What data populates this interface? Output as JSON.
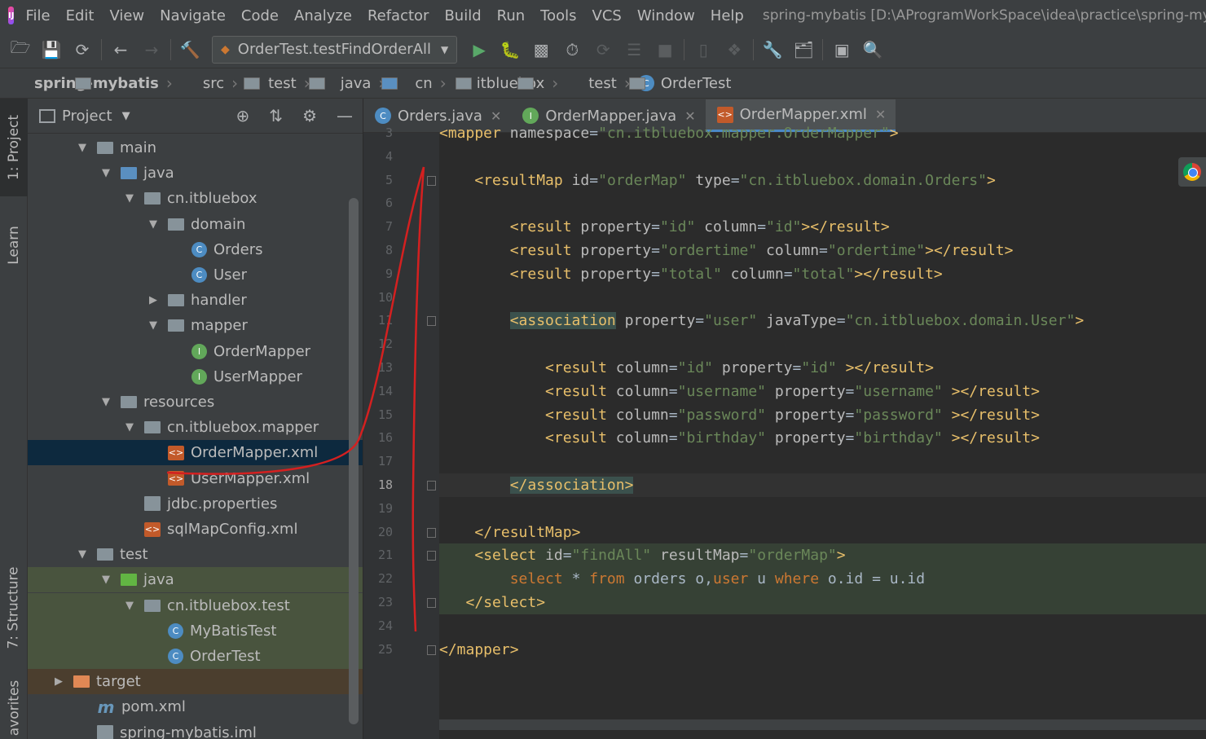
{
  "menu": [
    "File",
    "Edit",
    "View",
    "Navigate",
    "Code",
    "Analyze",
    "Refactor",
    "Build",
    "Run",
    "Tools",
    "VCS",
    "Window",
    "Help"
  ],
  "window_title": "spring-mybatis [D:\\AProgramWorkSpace\\idea\\practice\\spring-myba",
  "run_config": "OrderTest.testFindOrderAll",
  "breadcrumb": [
    "spring-mybatis",
    "src",
    "test",
    "java",
    "cn",
    "itbluebox",
    "test",
    "OrderTest"
  ],
  "side_tabs": {
    "project": "1: Project",
    "learn": "Learn",
    "structure": "7: Structure",
    "favorites": "avorites"
  },
  "project_panel": {
    "title": "Project",
    "tree": [
      {
        "label": "main",
        "icon": "folder",
        "depth": 1,
        "arrow": "▼"
      },
      {
        "label": "java",
        "icon": "folder-blue",
        "depth": 2,
        "arrow": "▼"
      },
      {
        "label": "cn.itbluebox",
        "icon": "pkg",
        "depth": 3,
        "arrow": "▼"
      },
      {
        "label": "domain",
        "icon": "pkg",
        "depth": 4,
        "arrow": "▼"
      },
      {
        "label": "Orders",
        "icon": "cls",
        "depth": 5,
        "arrow": ""
      },
      {
        "label": "User",
        "icon": "cls",
        "depth": 5,
        "arrow": ""
      },
      {
        "label": "handler",
        "icon": "pkg",
        "depth": 4,
        "arrow": "▶"
      },
      {
        "label": "mapper",
        "icon": "pkg",
        "depth": 4,
        "arrow": "▼"
      },
      {
        "label": "OrderMapper",
        "icon": "intf",
        "depth": 5,
        "arrow": ""
      },
      {
        "label": "UserMapper",
        "icon": "intf",
        "depth": 5,
        "arrow": ""
      },
      {
        "label": "resources",
        "icon": "folder",
        "depth": 2,
        "arrow": "▼"
      },
      {
        "label": "cn.itbluebox.mapper",
        "icon": "pkg",
        "depth": 3,
        "arrow": "▼"
      },
      {
        "label": "OrderMapper.xml",
        "icon": "xml",
        "depth": 4,
        "arrow": "",
        "state": "sel"
      },
      {
        "label": "UserMapper.xml",
        "icon": "xml",
        "depth": 4,
        "arrow": ""
      },
      {
        "label": "jdbc.properties",
        "icon": "props",
        "depth": 3,
        "arrow": ""
      },
      {
        "label": "sqlMapConfig.xml",
        "icon": "xml",
        "depth": 3,
        "arrow": ""
      },
      {
        "label": "test",
        "icon": "folder",
        "depth": 1,
        "arrow": "▼"
      },
      {
        "label": "java",
        "icon": "folder-green",
        "depth": 2,
        "arrow": "▼",
        "state": "green"
      },
      {
        "label": "cn.itbluebox.test",
        "icon": "pkg",
        "depth": 3,
        "arrow": "▼",
        "state": "green"
      },
      {
        "label": "MyBatisTest",
        "icon": "cls",
        "depth": 4,
        "arrow": "",
        "state": "green"
      },
      {
        "label": "OrderTest",
        "icon": "cls",
        "depth": 4,
        "arrow": "",
        "state": "green"
      },
      {
        "label": "target",
        "icon": "folder-orange",
        "depth": 0,
        "arrow": "▶",
        "state": "orange"
      },
      {
        "label": "pom.xml",
        "icon": "mvn",
        "depth": 1,
        "arrow": ""
      },
      {
        "label": "spring-mybatis.iml",
        "icon": "props",
        "depth": 1,
        "arrow": ""
      }
    ]
  },
  "tabs": [
    {
      "label": "Orders.java",
      "icon": "C",
      "kind": "c"
    },
    {
      "label": "OrderMapper.java",
      "icon": "I",
      "kind": "i"
    },
    {
      "label": "OrderMapper.xml",
      "icon": "<>",
      "kind": "x",
      "active": true
    }
  ],
  "editor": {
    "current_line": 18,
    "lines": [
      {
        "n": 3,
        "html": "<span class='tg'>&lt;mapper</span> <span class='at'>namespace</span>=<span class='av'>\"cn.itbluebox.mapper.OrderMapper\"</span><span class='tg'>&gt;</span>"
      },
      {
        "n": 4,
        "html": ""
      },
      {
        "n": 5,
        "html": "    <span class='tg'>&lt;resultMap</span> <span class='at'>id</span>=<span class='av'>\"orderMap\"</span> <span class='at'>type</span>=<span class='av'>\"cn.itbluebox.domain.Orders\"</span><span class='tg'>&gt;</span>"
      },
      {
        "n": 6,
        "html": ""
      },
      {
        "n": 7,
        "html": "        <span class='tg'>&lt;result</span> <span class='at'>property</span>=<span class='av'>\"id\"</span> <span class='at'>column</span>=<span class='av'>\"id\"</span><span class='tg'>&gt;&lt;/result&gt;</span>"
      },
      {
        "n": 8,
        "html": "        <span class='tg'>&lt;result</span> <span class='at'>property</span>=<span class='av'>\"ordertime\"</span> <span class='at'>column</span>=<span class='av'>\"ordertime\"</span><span class='tg'>&gt;&lt;/result&gt;</span>"
      },
      {
        "n": 9,
        "html": "        <span class='tg'>&lt;result</span> <span class='at'>property</span>=<span class='av'>\"total\"</span> <span class='at'>column</span>=<span class='av'>\"total\"</span><span class='tg'>&gt;&lt;/result&gt;</span>"
      },
      {
        "n": 10,
        "html": ""
      },
      {
        "n": 11,
        "html": "        <span class='tg hl'>&lt;association</span> <span class='at'>property</span>=<span class='av'>\"user\"</span> <span class='at'>javaType</span>=<span class='av'>\"cn.itbluebox.domain.User\"</span><span class='tg'>&gt;</span>"
      },
      {
        "n": 12,
        "html": ""
      },
      {
        "n": 13,
        "html": "            <span class='tg'>&lt;result</span> <span class='at'>column</span>=<span class='av'>\"id\"</span> <span class='at'>property</span>=<span class='av'>\"id\"</span> <span class='tg'>&gt;&lt;/result&gt;</span>"
      },
      {
        "n": 14,
        "html": "            <span class='tg'>&lt;result</span> <span class='at'>column</span>=<span class='av'>\"username\"</span> <span class='at'>property</span>=<span class='av'>\"username\"</span> <span class='tg'>&gt;&lt;/result&gt;</span>"
      },
      {
        "n": 15,
        "html": "            <span class='tg'>&lt;result</span> <span class='at'>column</span>=<span class='av'>\"password\"</span> <span class='at'>property</span>=<span class='av'>\"password\"</span> <span class='tg'>&gt;&lt;/result&gt;</span>"
      },
      {
        "n": 16,
        "html": "            <span class='tg'>&lt;result</span> <span class='at'>column</span>=<span class='av'>\"birthday\"</span> <span class='at'>property</span>=<span class='av'>\"birthday\"</span> <span class='tg'>&gt;&lt;/result&gt;</span>"
      },
      {
        "n": 17,
        "html": ""
      },
      {
        "n": 18,
        "html": "        <span class='tg hl'>&lt;/association&gt;</span>"
      },
      {
        "n": 19,
        "html": ""
      },
      {
        "n": 20,
        "html": "    <span class='tg'>&lt;/resultMap&gt;</span>"
      },
      {
        "n": 21,
        "html": "    <span class='tg'>&lt;select</span> <span class='at'>id</span>=<span class='av'>\"findAll\"</span> <span class='at'>resultMap</span>=<span class='av'>\"orderMap\"</span><span class='tg'>&gt;</span>"
      },
      {
        "n": 22,
        "html": "        <span class='kw'>select</span> * <span class='kw'>from</span> orders o,<span class='kw'>user</span> u <span class='kw'>where</span> o.id = u.id"
      },
      {
        "n": 23,
        "html": "   <span class='tg'>&lt;/select&gt;</span>"
      },
      {
        "n": 24,
        "html": ""
      },
      {
        "n": 25,
        "html": "<span class='tg'>&lt;/mapper&gt;</span>"
      }
    ]
  }
}
